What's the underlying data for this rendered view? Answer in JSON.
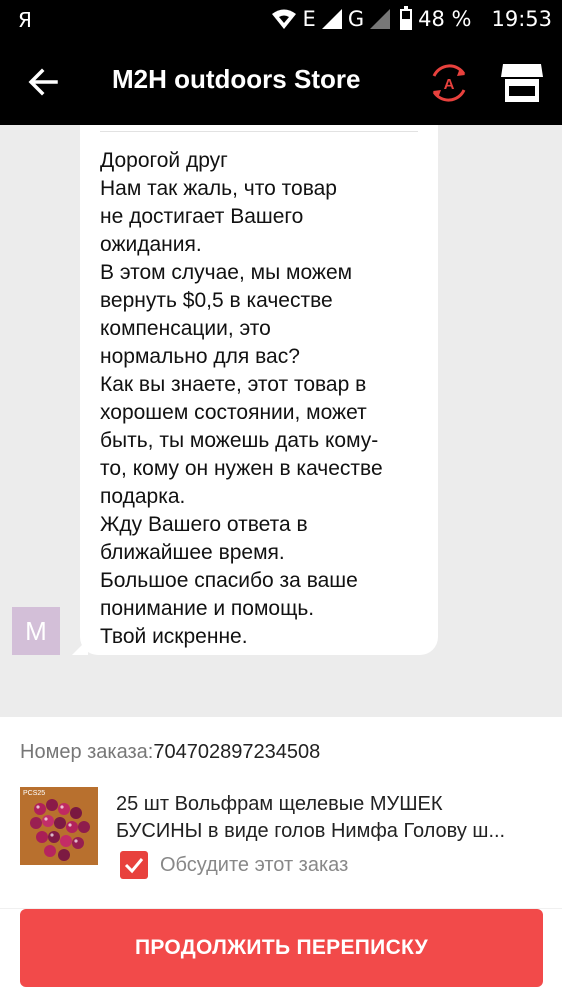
{
  "status_bar": {
    "carrier": "Я",
    "network_e": "E",
    "network_g": "G",
    "battery": "48 %",
    "time": "19:53"
  },
  "header": {
    "title": "M2H outdoors Store",
    "icons": [
      "back-arrow-icon",
      "auto-translate-icon",
      "store-icon"
    ]
  },
  "message": {
    "avatar_letter": "M",
    "lines": [
      "Дорогой друг",
      "Нам так жаль, что товар",
      "не достигает Вашего",
      "ожидания.",
      "В этом случае, мы можем",
      "вернуть $0,5 в качестве",
      "компенсации, это",
      "нормально для вас?",
      "Как вы знаете, этот товар в",
      "хорошем состоянии, может",
      "быть, ты можешь дать кому-",
      "то, кому он нужен в качестве",
      "подарка.",
      "Жду Вашего ответа в",
      "ближайшее время.",
      "Большое спасибо за ваше",
      "понимание и помощь.",
      "Твой искренне."
    ]
  },
  "order": {
    "label": "Номер заказа:",
    "number": "704702897234508",
    "image_tag": "PCS25",
    "product_line1": "25 шт Вольфрам щелевые МУШЕК",
    "product_line2": "БУСИНЫ в виде голов Нимфа Голову ш...",
    "discuss_label": "Обсудите этот заказ",
    "discuss_checked": true
  },
  "cta": {
    "label": "ПРОДОЛЖИТЬ ПЕРЕПИСКУ"
  },
  "colors": {
    "accent": "#f24a4a",
    "header_bg": "#000000",
    "chat_bg": "#ececec",
    "avatar_bg": "#d3bfd8",
    "translate_icon": "#e8413d"
  }
}
